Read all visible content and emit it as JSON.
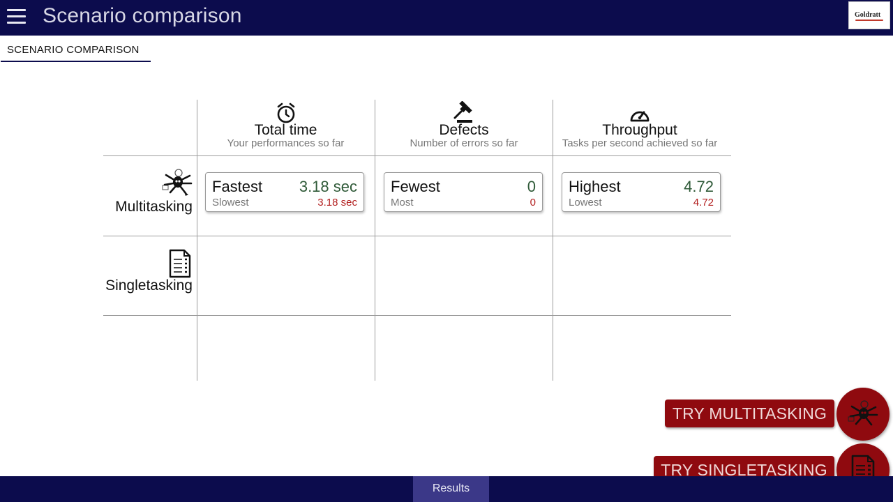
{
  "header": {
    "title": "Scenario comparison",
    "menu_icon": "hamburger-menu-icon",
    "logo_text": "Goldratt"
  },
  "tabs": [
    {
      "label": "SCENARIO COMPARISON",
      "active": true
    }
  ],
  "metrics": [
    {
      "icon": "alarm-clock-icon",
      "title": "Total time",
      "subtitle": "Your performances so far"
    },
    {
      "icon": "gavel-icon",
      "title": "Defects",
      "subtitle": "Number of errors so far"
    },
    {
      "icon": "speedometer-icon",
      "title": "Throughput",
      "subtitle": "Tasks per second achieved so far"
    }
  ],
  "scenarios": [
    {
      "label": "Multitasking",
      "icon": "multitasking-figure-icon",
      "results": [
        {
          "best_label": "Fastest",
          "best_value": "3.18 sec",
          "worst_label": "Slowest",
          "worst_value": "3.18 sec"
        },
        {
          "best_label": "Fewest",
          "best_value": "0",
          "worst_label": "Most",
          "worst_value": "0"
        },
        {
          "best_label": "Highest",
          "best_value": "4.72",
          "worst_label": "Lowest",
          "worst_value": "4.72"
        }
      ]
    },
    {
      "label": "Singletasking",
      "icon": "document-list-icon",
      "results": []
    }
  ],
  "actions": {
    "try_multitasking": "TRY MULTITASKING",
    "try_singletasking": "TRY SINGLETASKING"
  },
  "footer": {
    "results_tab": "Results"
  },
  "colors": {
    "navy": "#0c0c4d",
    "accent_red": "#8f0a0f",
    "best_value": "#2f5a38",
    "worst_value": "#b21e1e",
    "results_tab": "#3b3888"
  }
}
